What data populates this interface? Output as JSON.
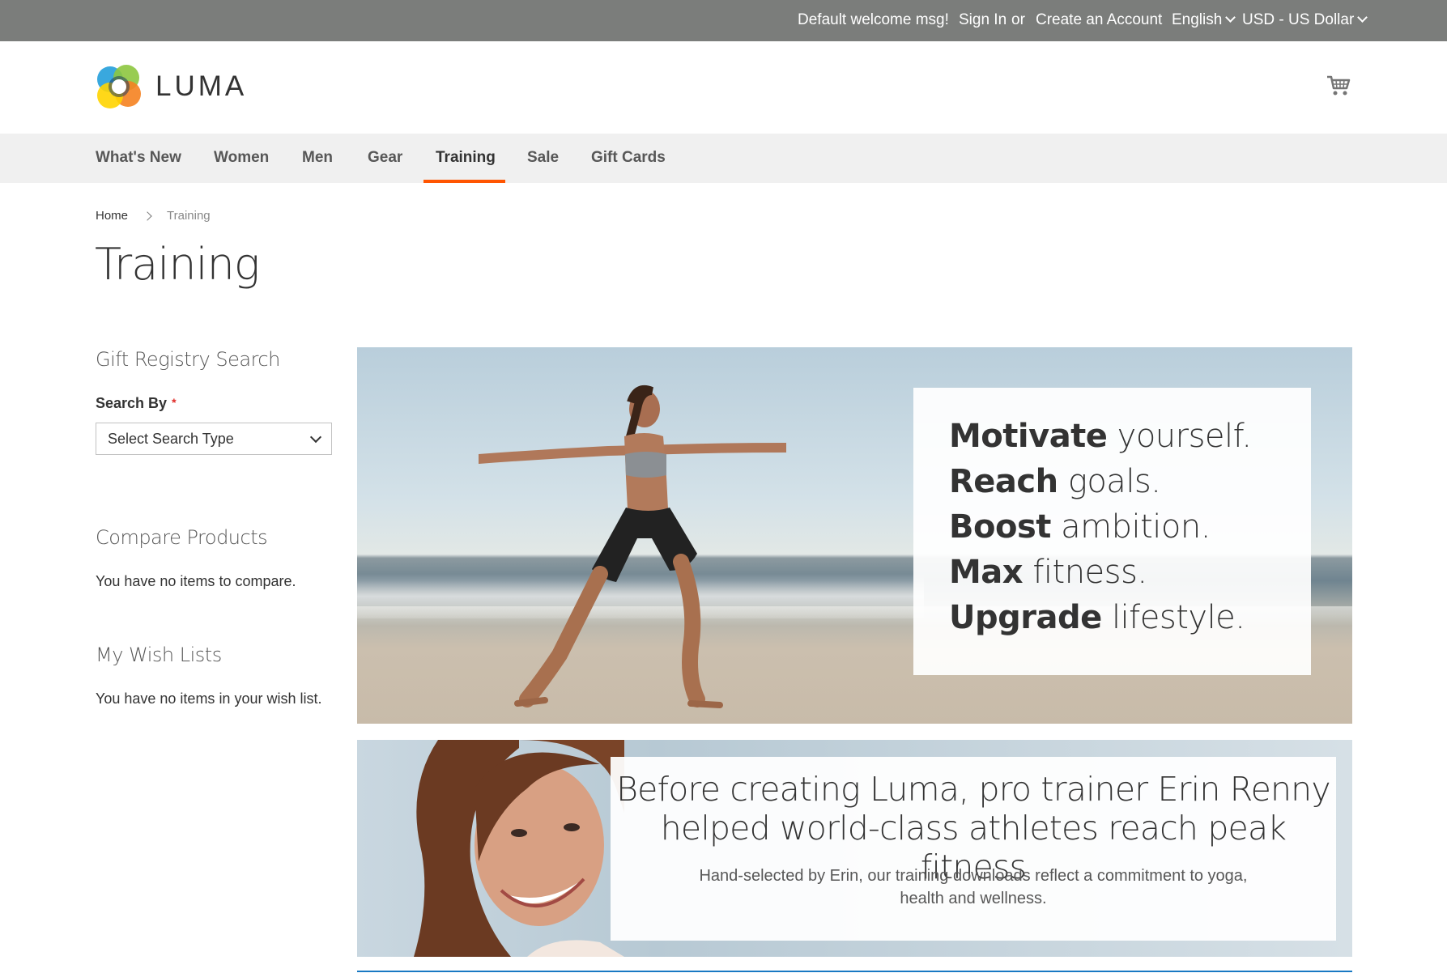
{
  "panel": {
    "welcome": "Default welcome msg!",
    "sign_in": "Sign In",
    "or": "or",
    "create_account": "Create an Account",
    "language": "English",
    "currency": "USD - US Dollar"
  },
  "header": {
    "logo_text": "LUMA",
    "cart_icon": "shopping-cart-icon"
  },
  "nav": {
    "items": [
      "What's New",
      "Women",
      "Men",
      "Gear",
      "Training",
      "Sale",
      "Gift Cards"
    ],
    "active": "Training",
    "accent_color": "#ff5501"
  },
  "breadcrumb": {
    "home": "Home",
    "current": "Training"
  },
  "page_title": "Training",
  "sidebar": {
    "gift_registry": {
      "heading": "Gift Registry Search",
      "search_by_label": "Search By",
      "required_mark": "*",
      "select_value": "Select Search Type"
    },
    "compare": {
      "heading": "Compare Products",
      "text": "You have no items to compare."
    },
    "wishlist": {
      "heading": "My Wish Lists",
      "text": "You have no items in your wish list."
    }
  },
  "hero1": {
    "lines": [
      {
        "bold": "Motivate",
        "rest": " yourself."
      },
      {
        "bold": "Reach",
        "rest": " goals."
      },
      {
        "bold": "Boost",
        "rest": " ambition."
      },
      {
        "bold": "Max",
        "rest": " fitness."
      },
      {
        "bold": "Upgrade",
        "rest": " lifestyle."
      }
    ]
  },
  "hero2": {
    "headline_1": "Before creating Luma, pro trainer Erin Renny",
    "headline_2": "helped world-class athletes reach peak fitness",
    "sub_1": "Hand-selected by Erin, our training downloads reflect a commitment to yoga,",
    "sub_2": "health and wellness."
  }
}
